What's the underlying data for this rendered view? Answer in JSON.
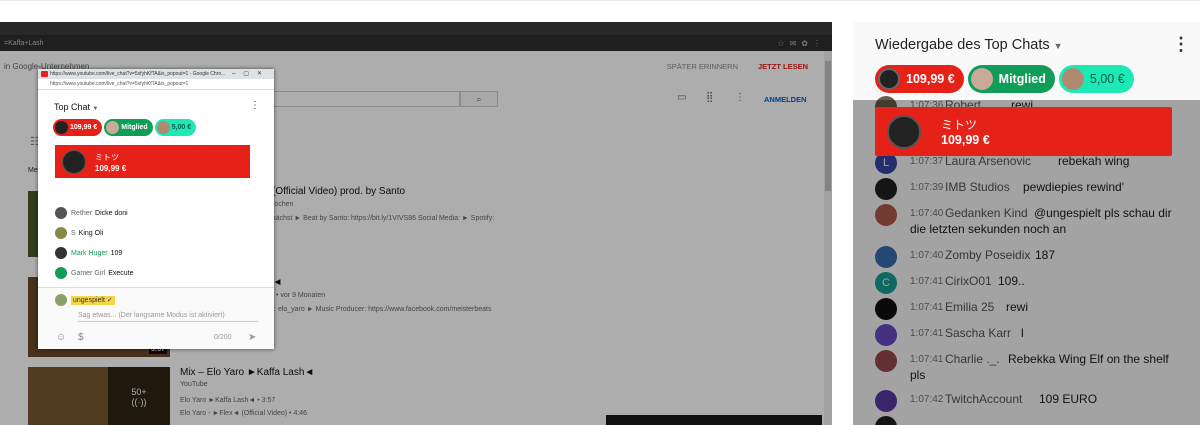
{
  "screen": {
    "address_text": "=Kaffa+Lash",
    "notice": {
      "text": "in Google-Unternehmen",
      "later": "SPÄTER ERINNERN",
      "now": "JETZT LESEN"
    },
    "signin": "ANMELDEN",
    "section_label": "Mei",
    "popup": {
      "titlebar": "https://www.youtube.com/live_chat?v=5xfyhKfTA&is_popout=1 - Google Chro...",
      "address": "https://www.youtube.com/live_chat?v=5xfyhKfTA&is_popout=1",
      "top_chat": "Top Chat",
      "tickers": [
        {
          "amount": "109,99 €",
          "color": "#e62117"
        },
        {
          "amount": "Mitglied",
          "color": "#0f9d58"
        },
        {
          "amount": "5,00 €",
          "color": "#1de9b6"
        }
      ],
      "card": {
        "name": "ミトツ",
        "amount": "109,99 €"
      },
      "messages": [
        {
          "author": "Rether",
          "text": "Dicke doni"
        },
        {
          "author": "S",
          "text": "King Oli"
        },
        {
          "author": "Mark Huger",
          "text": "109"
        },
        {
          "author": "Gamer Girl",
          "text": "Execute"
        }
      ],
      "me": "ungespielt ✓",
      "placeholder": "Sag etwas... (Der langsame Modus ist aktiviert)",
      "counter": "0/200"
    },
    "videos": [
      {
        "title": "H (Official Video) prod. by Santo",
        "meta": "9 Wochen",
        "desc": "emnächst ► Beat by Santo: https://bit.ly/1VIVS86 Social Media: ► Spotify:"
      },
      {
        "title": "sh◄",
        "meta": "rufe • vor 9 Monaten",
        "desc": "ram: elo_yaro ► Music Producer: https://www.facebook.com/meisterbeats",
        "duration": "3:57"
      },
      {
        "title": "Mix – Elo Yaro ►Kaffa Lash◄",
        "meta": "YouTube",
        "line1": "Elo Yaro ►Kaffa Lash◄ • 3:57",
        "line2": "Elo Yaro - ►Flex◄ (Official Video) • 4:46",
        "count": "50+"
      }
    ]
  },
  "panel": {
    "title": "Wiedergabe des Top Chats",
    "tickers": [
      {
        "amount": "109,99 €",
        "color": "#e62117",
        "text_color": "#ffffff"
      },
      {
        "amount": "Mitglied",
        "color": "#0f9d58",
        "text_color": "#ffffff"
      },
      {
        "amount": "5,00 €",
        "color": "#1de9b6",
        "text_color": "#0a5a48"
      }
    ],
    "card": {
      "name": "ミトツ",
      "amount": "109,99 €"
    },
    "messages": [
      {
        "time": "1:07:36",
        "author": "Robert",
        "text": "rewi",
        "avatar": "#6b5b4b",
        "initial": ""
      },
      {
        "time": "1:07:37",
        "author": "Laura Arsenovic",
        "text": "rebekah wing",
        "avatar": "#3949ab",
        "initial": "L"
      },
      {
        "time": "1:07:39",
        "author": "IMB Studios",
        "text": "pewdiepies rewind'",
        "avatar": "#222222",
        "initial": ""
      },
      {
        "time": "1:07:40",
        "author": "Gedanken Kind",
        "text": "@ungespielt pls schau dir",
        "text2": "die letzten sekunden noch an",
        "avatar": "#b85c4a",
        "initial": ""
      },
      {
        "time": "1:07:40",
        "author": "Zomby Poseidix",
        "text": "187",
        "avatar": "#3b6fb5",
        "initial": ""
      },
      {
        "time": "1:07:41",
        "author": "CirixO01",
        "text": "109..",
        "avatar": "#1aa39a",
        "initial": "C"
      },
      {
        "time": "1:07:41",
        "author": "Emilia 25",
        "text": "rewi",
        "avatar": "#111111",
        "initial": ""
      },
      {
        "time": "1:07:41",
        "author": "Sascha Karr",
        "text": "l",
        "avatar": "#6a4fc9",
        "initial": ""
      },
      {
        "time": "1:07:41",
        "author": "Charlie ._.",
        "text": "Rebekka Wing Elf on the shelf",
        "text2": "pls",
        "avatar": "#9a4b4b",
        "initial": ""
      },
      {
        "time": "1:07:42",
        "author": "TwitchAccount",
        "text": "109 EURO",
        "avatar": "#5b3aa8",
        "initial": ""
      }
    ]
  }
}
